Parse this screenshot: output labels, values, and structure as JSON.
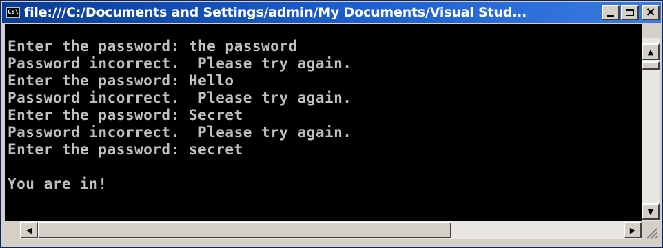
{
  "window": {
    "title": "file:///C:/Documents and Settings/admin/My Documents/Visual Stud...",
    "icon_label": "C:\\"
  },
  "titlebar_buttons": {
    "minimize_icon": "minimize-icon",
    "maximize_icon": "maximize-icon",
    "close_icon": "close-icon"
  },
  "console": {
    "lines": [
      "Enter the password: the password",
      "Password incorrect.  Please try again.",
      "Enter the password: Hello",
      "Password incorrect.  Please try again.",
      "Enter the password: Secret",
      "Password incorrect.  Please try again.",
      "Enter the password: secret",
      "",
      "You are in!"
    ],
    "background_color": "#000000",
    "text_color": "#c0c0c0"
  },
  "scrollbars": {
    "up_arrow": "▲",
    "down_arrow": "▼",
    "left_arrow": "◀",
    "right_arrow": "▶"
  },
  "colors": {
    "titlebar_start": "#0a3c96",
    "titlebar_end": "#3a7be0",
    "chrome": "#d4d0c8"
  }
}
